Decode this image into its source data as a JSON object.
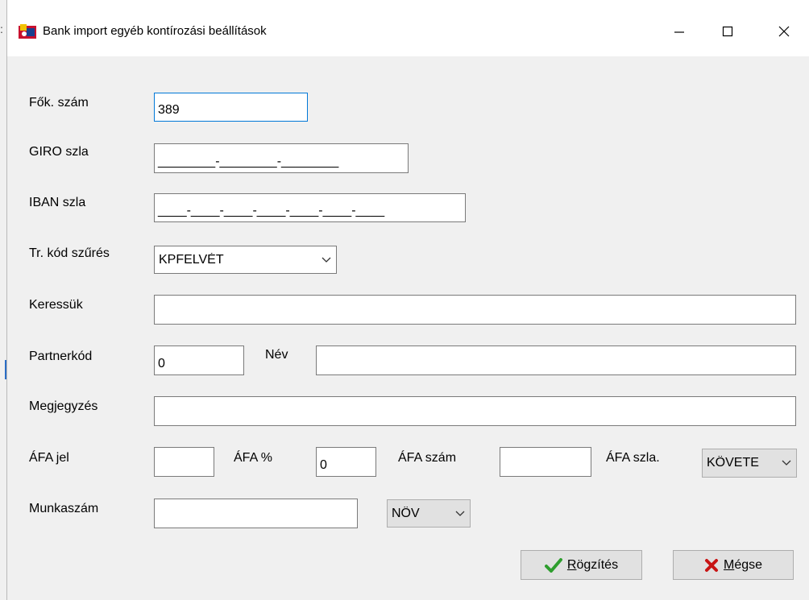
{
  "window": {
    "title": "Bank import egyéb kontírozási beállítások"
  },
  "form": {
    "fok_szam": {
      "label": "Fők. szám",
      "value": "389"
    },
    "giro": {
      "label": "GIRO szla",
      "value": "________-________-________"
    },
    "iban": {
      "label": "IBAN szla",
      "value": "____-____-____-____-____-____-____"
    },
    "tr_kod": {
      "label": "Tr. kód szűrés",
      "value": "KPFELVÉT"
    },
    "keressuk": {
      "label": "Keressük",
      "value": ""
    },
    "partnerkod": {
      "label": "Partnerkód",
      "value": "0"
    },
    "nev": {
      "label": "Név",
      "value": ""
    },
    "megjegyzes": {
      "label": "Megjegyzés",
      "value": ""
    },
    "afa_jel": {
      "label": "ÁFA jel",
      "value": ""
    },
    "afa_pct": {
      "label": "ÁFA %",
      "value": "0"
    },
    "afa_szam": {
      "label": "ÁFA szám",
      "value": ""
    },
    "afa_szla": {
      "label": "ÁFA szla.",
      "value": "KÖVETE"
    },
    "munkaszam": {
      "label": "Munkaszám",
      "value": "",
      "dir_value": "NÖV"
    }
  },
  "buttons": {
    "save_first": "R",
    "save_rest": "ögzítés",
    "cancel_first": "M",
    "cancel_rest": "égse"
  },
  "background": {
    "marks": ":"
  },
  "colors": {
    "focus_border": "#0078d7",
    "save_check": "#2e9e2e",
    "cancel_x": "#c81414"
  }
}
